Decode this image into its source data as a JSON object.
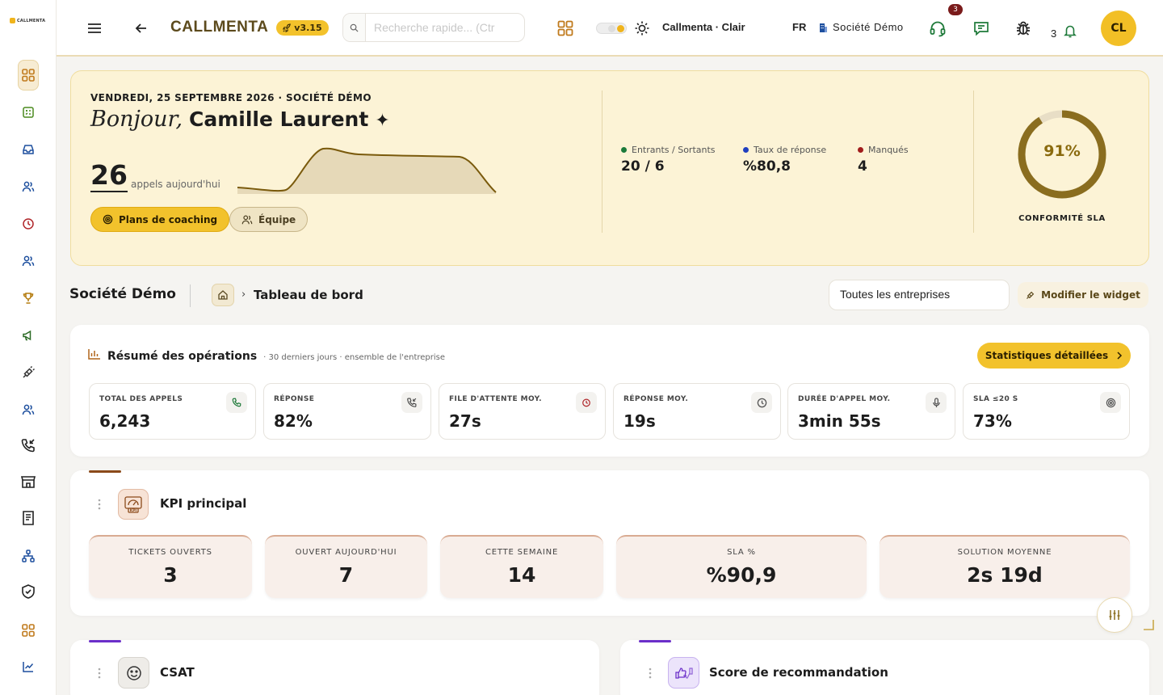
{
  "app": {
    "brand": "CALLMENTA",
    "logo_text": "CALLMENTA",
    "version": "v3.15"
  },
  "topbar": {
    "search_placeholder": "Recherche rapide... (Ctr",
    "theme_label": "Callmenta · Clair",
    "language": "FR",
    "company": "Société Démo",
    "support_badge": "3",
    "notifications_count": "3",
    "avatar_initials": "CL"
  },
  "hero": {
    "date_line": "VENDREDI, 25 SEPTEMBRE 2026 · SOCIÉTÉ DÉMO",
    "greeting": "Bonjour,",
    "user_name": "Camille Laurent",
    "sparkle": "✦",
    "calls_today": "26",
    "calls_label": "appels aujourd'hui",
    "btn_coaching": "Plans de coaching",
    "btn_team": "Équipe",
    "stats": [
      {
        "label": "Entrants / Sortants",
        "value": "20 / 6",
        "color": "#1b7a3a"
      },
      {
        "label": "Taux de réponse",
        "value": "%80,8",
        "color": "#1f3fbf"
      },
      {
        "label": "Manqués",
        "value": "4",
        "color": "#a11c1c"
      }
    ],
    "sla_value": "91%",
    "sla_fraction": 0.91,
    "sla_label": "CONFORMITÉ SLA"
  },
  "breadcrumb": {
    "company": "Société Démo",
    "separator": "›",
    "current": "Tableau de bord",
    "company_select": "Toutes les entreprises",
    "edit_widget": "Modifier le widget"
  },
  "ops": {
    "title": "Résumé des opérations",
    "subtitle": "· 30 derniers jours · ensemble de l'entreprise",
    "btn_stats": "Statistiques détaillées",
    "metrics": [
      {
        "label": "TOTAL DES APPELS",
        "value": "6,243",
        "icon": "phone-icon"
      },
      {
        "label": "RÉPONSE",
        "value": "82%",
        "icon": "phone-incoming-icon"
      },
      {
        "label": "FILE D'ATTENTE MOY.",
        "value": "27s",
        "icon": "timer-icon"
      },
      {
        "label": "RÉPONSE MOY.",
        "value": "19s",
        "icon": "clock-icon"
      },
      {
        "label": "DURÉE D'APPEL MOY.",
        "value": "3min 55s",
        "icon": "mic-icon"
      },
      {
        "label": "SLA ≤20 S",
        "value": "73%",
        "icon": "target-icon"
      }
    ]
  },
  "kpi": {
    "title": "KPI principal",
    "icon_text": "KPI",
    "tiles": [
      {
        "label": "TICKETS OUVERTS",
        "value": "3"
      },
      {
        "label": "OUVERT AUJOURD'HUI",
        "value": "7"
      },
      {
        "label": "CETTE SEMAINE",
        "value": "14"
      },
      {
        "label": "SLA %",
        "value": "%90,9"
      },
      {
        "label": "SOLUTION MOYENNE",
        "value": "2s 19d"
      }
    ]
  },
  "cards": {
    "csat_title": "CSAT",
    "nps_title": "Score de recommandation"
  },
  "colors": {
    "accent": "#f2c22c",
    "hero_bg": "#fcf3d6",
    "ring": "#8a6d1f",
    "kpi_accent": "#8b4a1a",
    "csat_accent": "#6b2fc9"
  }
}
